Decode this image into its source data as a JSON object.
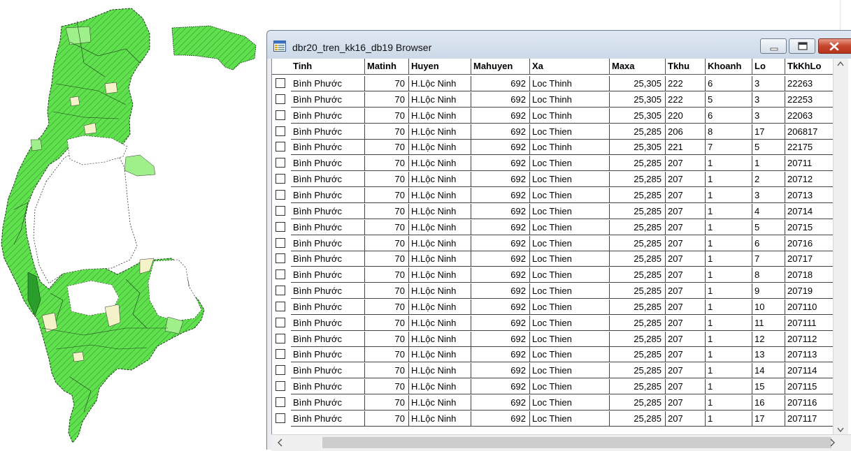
{
  "window": {
    "title": "dbr20_tren_kk16_db19 Browser",
    "buttons": [
      "minimize",
      "maximize",
      "close"
    ]
  },
  "columns": [
    "Tinh",
    "Matinh",
    "Huyen",
    "Mahuyen",
    "Xa",
    "Maxa",
    "Tkhu",
    "Khoanh",
    "Lo",
    "TkKhLo"
  ],
  "rows": [
    [
      "Bình Phước",
      "70",
      "H.Lộc Ninh",
      "692",
      "Loc Thinh",
      "25,305",
      "222",
      "6",
      "3",
      "22263"
    ],
    [
      "Bình Phước",
      "70",
      "H.Lộc Ninh",
      "692",
      "Loc Thinh",
      "25,305",
      "222",
      "5",
      "3",
      "22253"
    ],
    [
      "Bình Phước",
      "70",
      "H.Lộc Ninh",
      "692",
      "Loc Thinh",
      "25,305",
      "220",
      "6",
      "3",
      "22063"
    ],
    [
      "Bình Phước",
      "70",
      "H.Lộc Ninh",
      "692",
      "Loc Thien",
      "25,285",
      "206",
      "8",
      "17",
      "206817"
    ],
    [
      "Bình Phước",
      "70",
      "H.Lộc Ninh",
      "692",
      "Loc Thinh",
      "25,305",
      "221",
      "7",
      "5",
      "22175"
    ],
    [
      "Bình Phước",
      "70",
      "H.Lộc Ninh",
      "692",
      "Loc Thien",
      "25,285",
      "207",
      "1",
      "1",
      "20711"
    ],
    [
      "Bình Phước",
      "70",
      "H.Lộc Ninh",
      "692",
      "Loc Thien",
      "25,285",
      "207",
      "1",
      "2",
      "20712"
    ],
    [
      "Bình Phước",
      "70",
      "H.Lộc Ninh",
      "692",
      "Loc Thien",
      "25,285",
      "207",
      "1",
      "3",
      "20713"
    ],
    [
      "Bình Phước",
      "70",
      "H.Lộc Ninh",
      "692",
      "Loc Thien",
      "25,285",
      "207",
      "1",
      "4",
      "20714"
    ],
    [
      "Bình Phước",
      "70",
      "H.Lộc Ninh",
      "692",
      "Loc Thien",
      "25,285",
      "207",
      "1",
      "5",
      "20715"
    ],
    [
      "Bình Phước",
      "70",
      "H.Lộc Ninh",
      "692",
      "Loc Thien",
      "25,285",
      "207",
      "1",
      "6",
      "20716"
    ],
    [
      "Bình Phước",
      "70",
      "H.Lộc Ninh",
      "692",
      "Loc Thien",
      "25,285",
      "207",
      "1",
      "7",
      "20717"
    ],
    [
      "Bình Phước",
      "70",
      "H.Lộc Ninh",
      "692",
      "Loc Thien",
      "25,285",
      "207",
      "1",
      "8",
      "20718"
    ],
    [
      "Bình Phước",
      "70",
      "H.Lộc Ninh",
      "692",
      "Loc Thien",
      "25,285",
      "207",
      "1",
      "9",
      "20719"
    ],
    [
      "Bình Phước",
      "70",
      "H.Lộc Ninh",
      "692",
      "Loc Thien",
      "25,285",
      "207",
      "1",
      "10",
      "207110"
    ],
    [
      "Bình Phước",
      "70",
      "H.Lộc Ninh",
      "692",
      "Loc Thien",
      "25,285",
      "207",
      "1",
      "11",
      "207111"
    ],
    [
      "Bình Phước",
      "70",
      "H.Lộc Ninh",
      "692",
      "Loc Thien",
      "25,285",
      "207",
      "1",
      "12",
      "207112"
    ],
    [
      "Bình Phước",
      "70",
      "H.Lộc Ninh",
      "692",
      "Loc Thien",
      "25,285",
      "207",
      "1",
      "13",
      "207113"
    ],
    [
      "Bình Phước",
      "70",
      "H.Lộc Ninh",
      "692",
      "Loc Thien",
      "25,285",
      "207",
      "1",
      "14",
      "207114"
    ],
    [
      "Bình Phước",
      "70",
      "H.Lộc Ninh",
      "692",
      "Loc Thien",
      "25,285",
      "207",
      "1",
      "15",
      "207115"
    ],
    [
      "Bình Phước",
      "70",
      "H.Lộc Ninh",
      "692",
      "Loc Thien",
      "25,285",
      "207",
      "1",
      "16",
      "207116"
    ],
    [
      "Bình Phước",
      "70",
      "H.Lộc Ninh",
      "692",
      "Loc Thien",
      "25,285",
      "207",
      "1",
      "17",
      "207117"
    ]
  ],
  "numeric_columns": [
    1,
    3,
    5
  ],
  "colors": {
    "parcel_green": "#5fe04d",
    "parcel_light_green": "#9ff08a",
    "parcel_pale": "#f4f2c8",
    "parcel_dark_green": "#2a9e2a"
  }
}
